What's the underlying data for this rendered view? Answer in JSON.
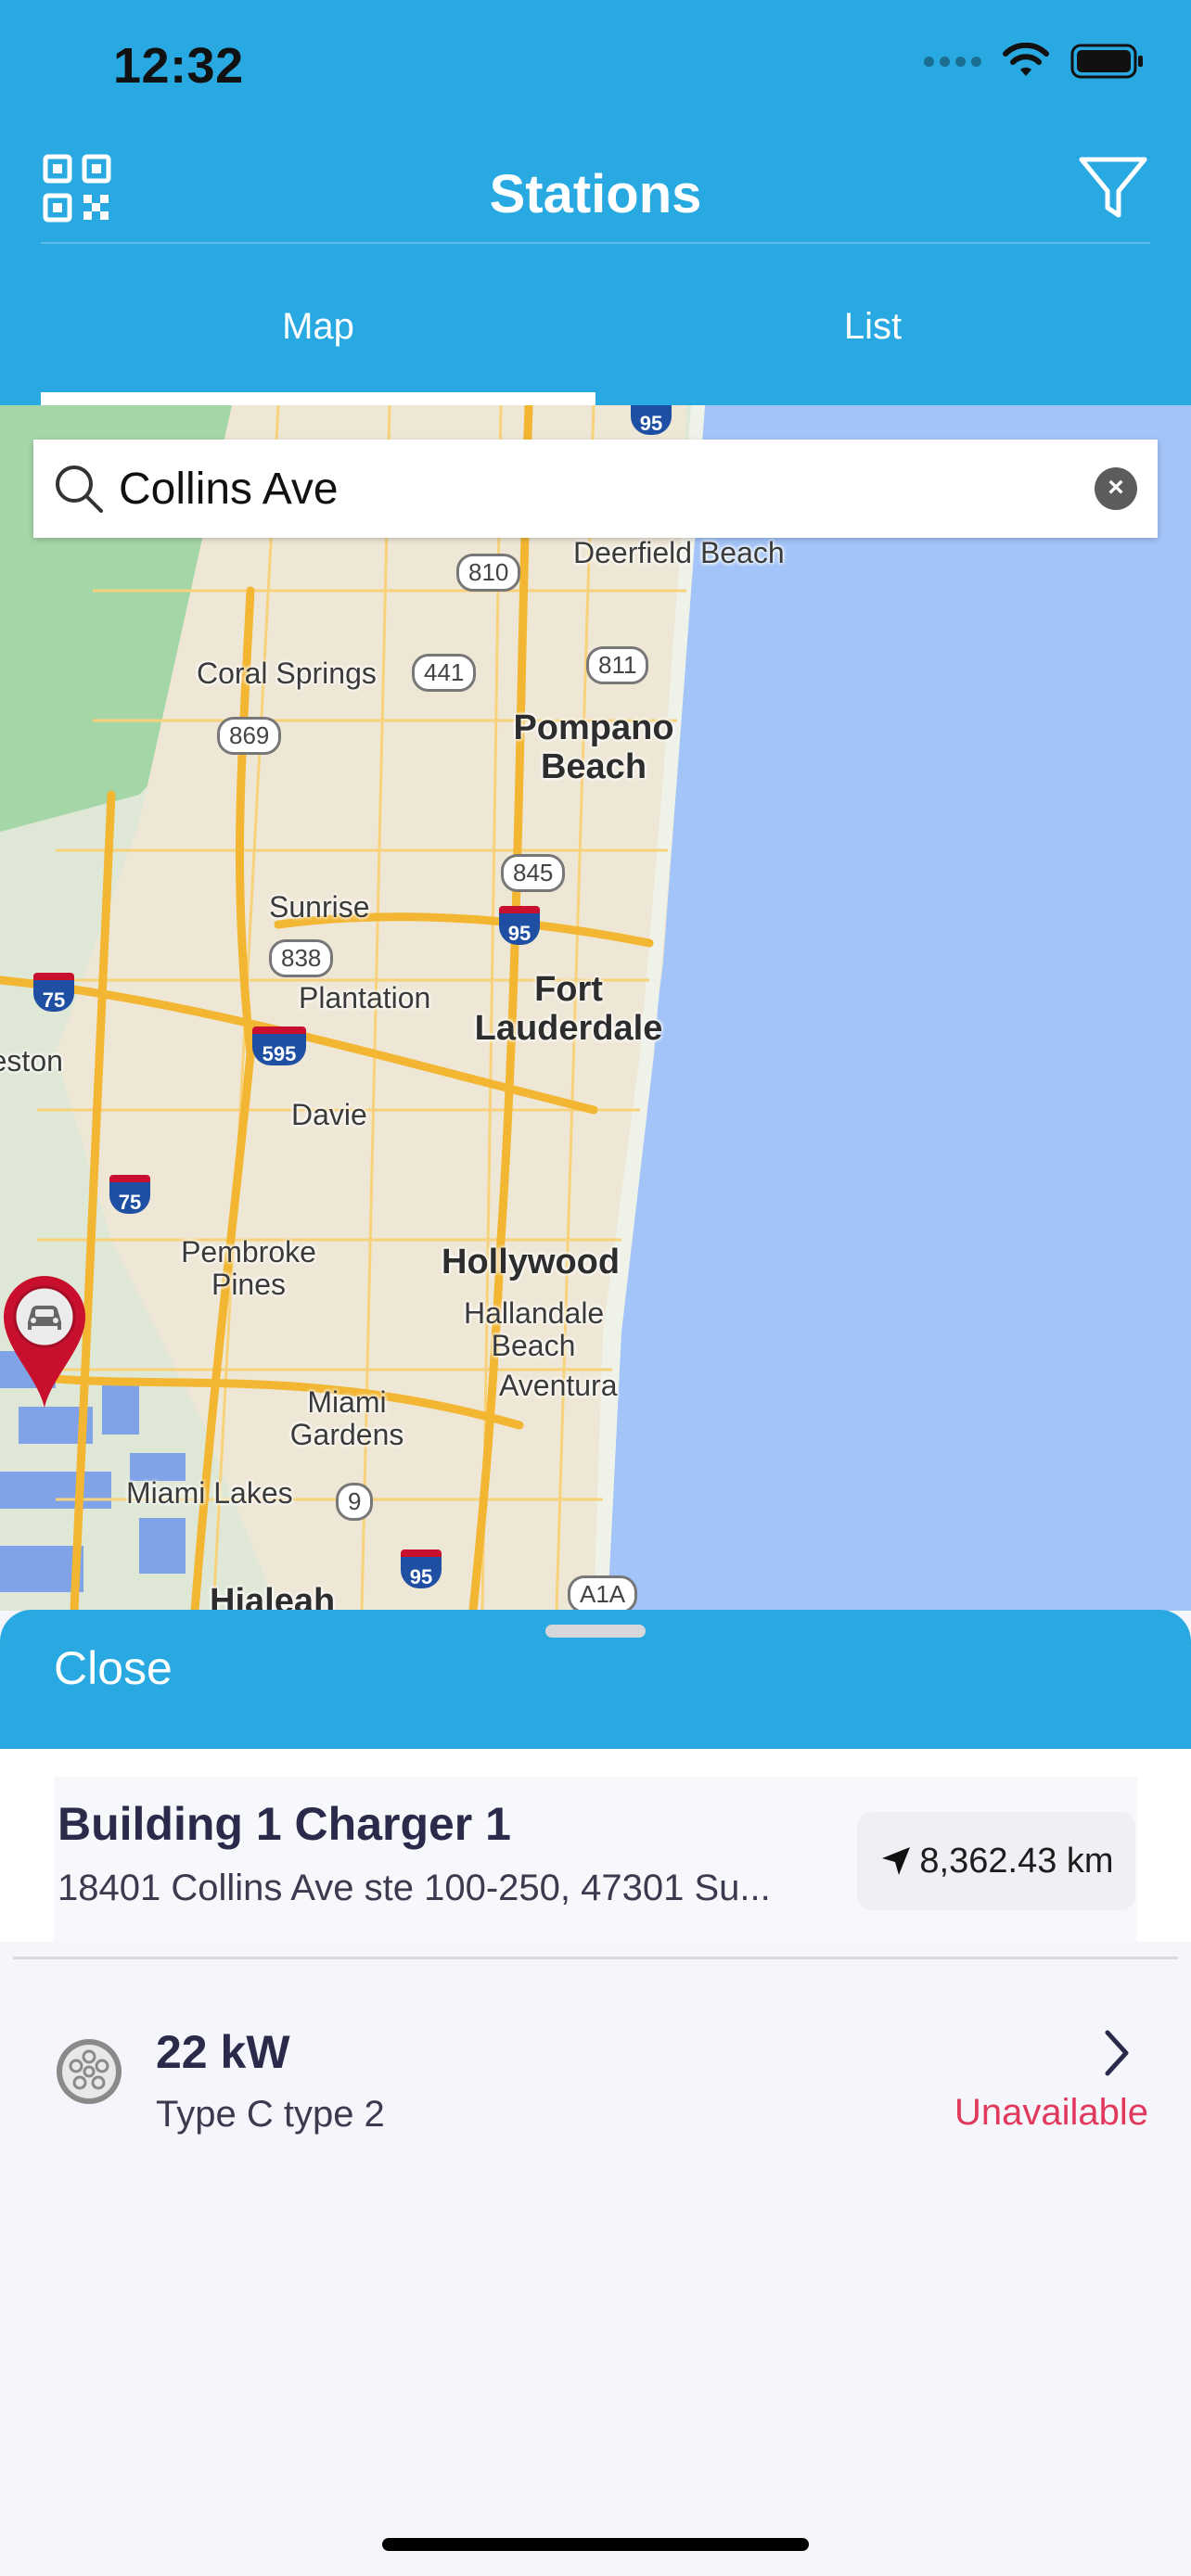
{
  "status_bar": {
    "time": "12:32"
  },
  "header": {
    "title": "Stations"
  },
  "tabs": [
    {
      "label": "Map",
      "active": true
    },
    {
      "label": "List",
      "active": false
    }
  ],
  "search": {
    "value": "Collins Ave"
  },
  "map": {
    "labels": {
      "deerfield_beach": "Deerfield Beach",
      "coral_springs": "Coral Springs",
      "pompano_beach": "Pompano Beach",
      "sunrise": "Sunrise",
      "plantation": "Plantation",
      "fort_lauderdale": "Fort Lauderdale",
      "weston": "Weston",
      "davie": "Davie",
      "pembroke_pines": "Pembroke Pines",
      "hollywood": "Hollywood",
      "hallandale_beach": "Hallandale Beach",
      "aventura": "Aventura",
      "miami_gardens": "Miami Gardens",
      "miami_lakes": "Miami Lakes",
      "hialeah": "Hialeah"
    },
    "routes": {
      "r810": "810",
      "r441": "441",
      "r811": "811",
      "r869": "869",
      "r845": "845",
      "r838": "838",
      "r9": "9",
      "a1a": "A1A",
      "i95a": "95",
      "i75a": "75",
      "i595": "595",
      "i75b": "75",
      "i95b": "95",
      "i95top": "95"
    }
  },
  "sheet": {
    "close_label": "Close",
    "station": {
      "name": "Building 1 Charger 1",
      "address": "18401 Collins Ave ste 100-250, 47301 Su...",
      "distance": "8,362.43 km"
    },
    "connector": {
      "power": "22 kW",
      "type": "Type C type 2",
      "status": "Unavailable"
    }
  },
  "colors": {
    "brand": "#29a9e1",
    "unavailable": "#e0395c",
    "water": "#a3c4f8",
    "pin": "#c8102e"
  }
}
